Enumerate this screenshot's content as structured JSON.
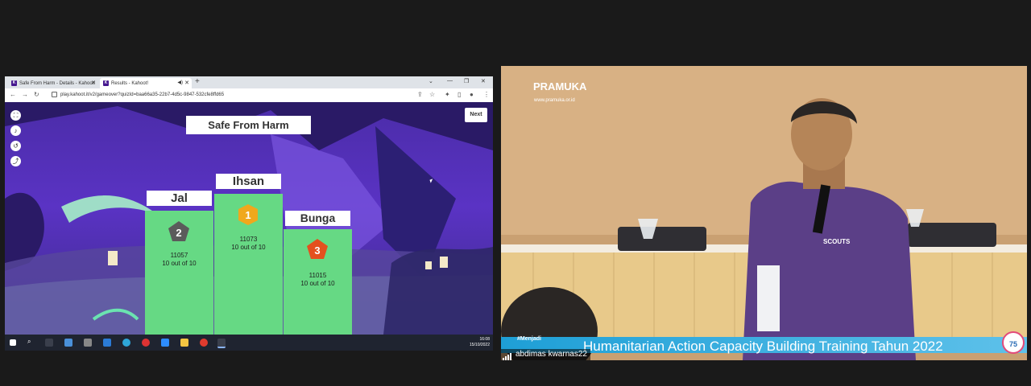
{
  "browser": {
    "tabs": [
      {
        "label": "Safe From Harm - Details - Kahoot!",
        "active": false
      },
      {
        "label": "Results - Kahoot!",
        "active": true
      }
    ],
    "new_tab": "+",
    "url": "play.kahoot.it/v2/gameover?quizId=baa66a35-22b7-4d5c-9847-532cfe8ffd65"
  },
  "kahoot": {
    "quiz_title": "Safe From Harm",
    "next_label": "Next",
    "podium": [
      {
        "rank": "2",
        "name": "Jal",
        "score": "11057",
        "detail": "10 out of 10"
      },
      {
        "rank": "1",
        "name": "Ihsan",
        "score": "11073",
        "detail": "10 out of 10"
      },
      {
        "rank": "3",
        "name": "Bunga",
        "score": "11015",
        "detail": "10 out of 10"
      }
    ]
  },
  "taskbar": {
    "time": "16:08",
    "date": "15/10/2022"
  },
  "video": {
    "org_name": "PRAMUKA",
    "org_url": "www.pramuka.or.id",
    "shirt_text": "SCOUTS",
    "banner_tag": "#Menjadi",
    "banner_text": "Humanitarian Action Capacity Building Training Tahun 2022",
    "badge": "75",
    "participant_name": "abdimas kwarnas22"
  },
  "colors": {
    "podium_green": "#66d984",
    "kahoot_purple": "#46178f",
    "banner_blue": "#1e9fd6"
  }
}
